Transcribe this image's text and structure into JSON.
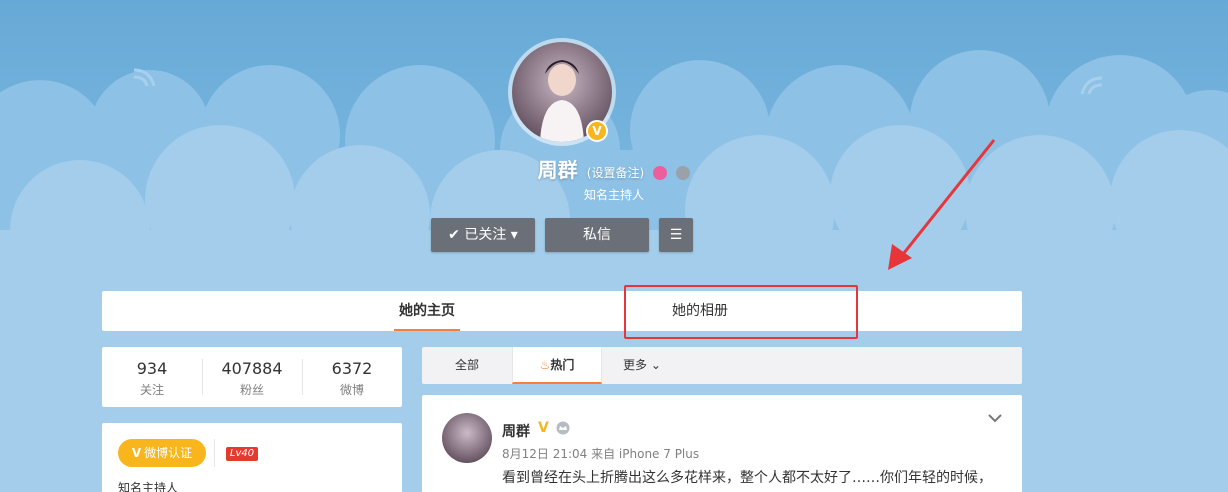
{
  "profile": {
    "name": "周群",
    "remark": "(设置备注)",
    "subtitle": "知名主持人",
    "verified_mark": "V"
  },
  "actions": {
    "follow_label": "已关注",
    "message_label": "私信"
  },
  "tabs": {
    "home": "她的主页",
    "album": "她的相册"
  },
  "stats": [
    {
      "num": "934",
      "label": "关注"
    },
    {
      "num": "407884",
      "label": "粉丝"
    },
    {
      "num": "6372",
      "label": "微博"
    }
  ],
  "info": {
    "verified_label": "微博认证",
    "verified_mark": "V",
    "level": "Lv40",
    "description": "知名主持人"
  },
  "feed_tabs": {
    "all": "全部",
    "hot": "热门",
    "more": "更多"
  },
  "post": {
    "author": "周群",
    "verified_mark": "V",
    "meta": "8月12日 21:04 来自 iPhone 7 Plus",
    "text": "看到曾经在头上折腾出这么多花样来，整个人都不太好了……你们年轻的时候，"
  },
  "colors": {
    "accent": "#fa7d3c",
    "verified": "#f8b61c",
    "highlight": "#e8353a",
    "button": "#6b6f77"
  }
}
